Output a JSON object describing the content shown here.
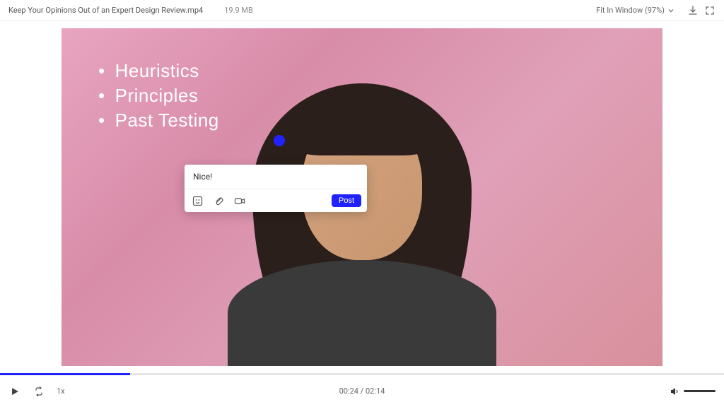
{
  "header": {
    "title": "Keep Your Opinions Out of an Expert Design Review.mp4",
    "filesize": "19.9 MB",
    "zoom_label": "Fit In Window (97%)"
  },
  "slide": {
    "bullets": [
      "Heuristics",
      "Principles",
      "Past Testing"
    ]
  },
  "comment": {
    "input_value": "Nice!",
    "post_label": "Post"
  },
  "player": {
    "progress_percent": 18,
    "speed_label": "1x",
    "current_time": "00:24",
    "total_time": "02:14"
  }
}
